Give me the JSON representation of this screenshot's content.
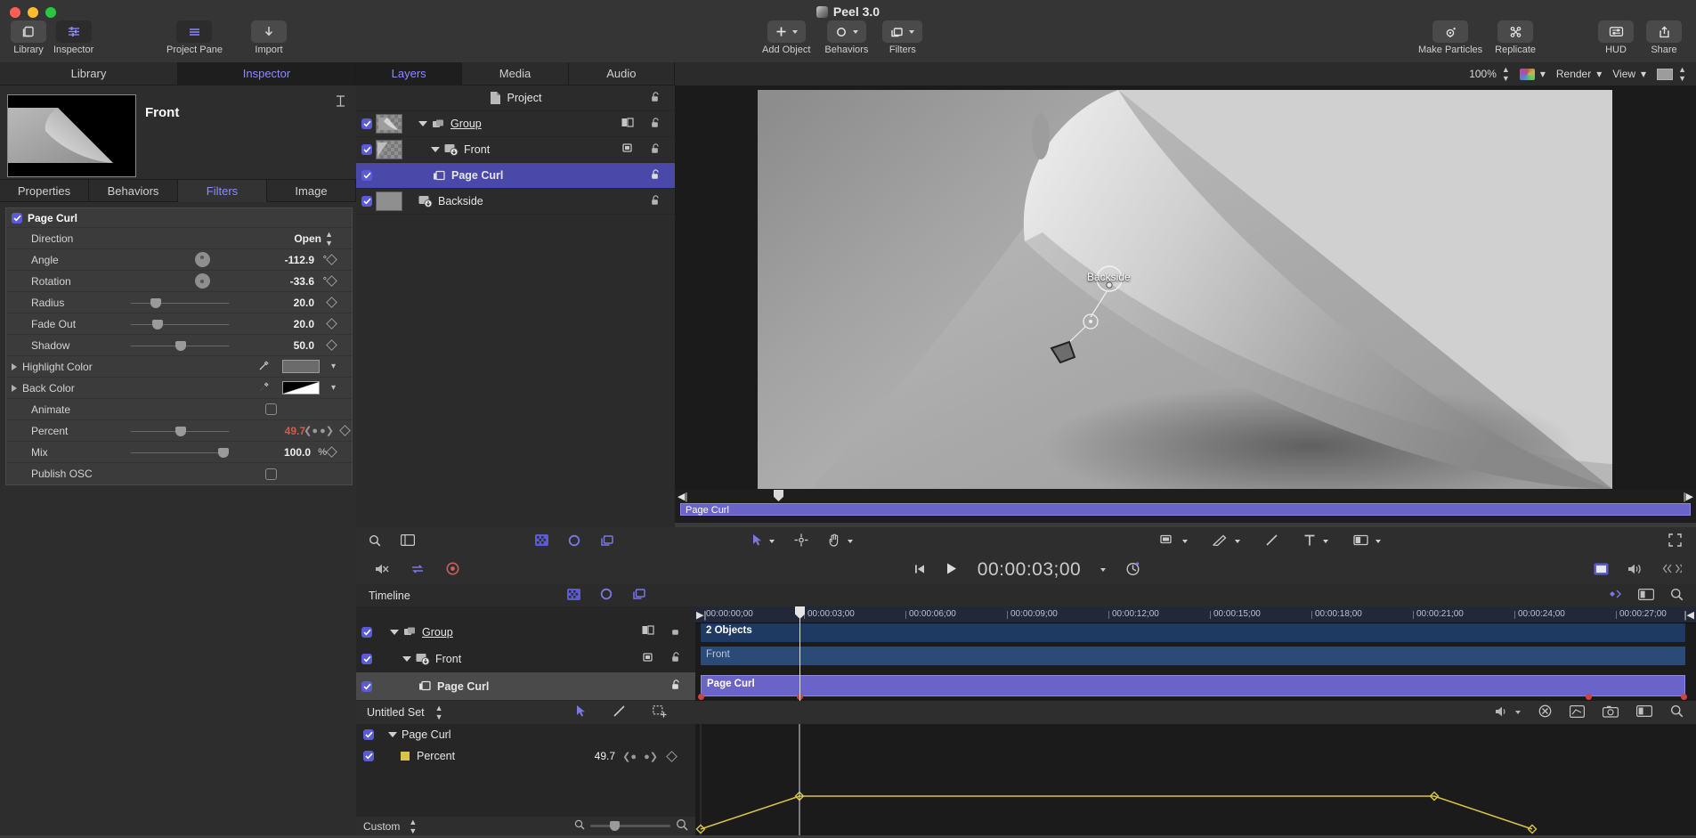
{
  "window": {
    "title": "Peel 3.0",
    "app_icon": "peel-app-icon"
  },
  "toolbar": {
    "left_items": [
      {
        "label": "Library",
        "icon": "library-icon",
        "active": false
      },
      {
        "label": "Inspector",
        "icon": "inspector-sliders-icon",
        "active": true
      }
    ],
    "mid_items": [
      {
        "label": "Project Pane",
        "icon": "project-pane-icon"
      },
      {
        "label": "Import",
        "icon": "import-arrow-down-icon"
      }
    ],
    "center_items": [
      {
        "label": "Add Object",
        "icon": "plus-icon"
      },
      {
        "label": "Behaviors",
        "icon": "gear-icon"
      },
      {
        "label": "Filters",
        "icon": "filters-stack-icon"
      }
    ],
    "right_items": [
      {
        "label": "Make Particles",
        "icon": "particles-icon"
      },
      {
        "label": "Replicate",
        "icon": "replicate-icon"
      },
      {
        "label": "HUD",
        "icon": "hud-icon"
      },
      {
        "label": "Share",
        "icon": "share-icon"
      }
    ]
  },
  "inspector": {
    "tabs": [
      {
        "label": "Library",
        "selected": false
      },
      {
        "label": "Inspector",
        "selected": true
      }
    ],
    "object_title": "Front",
    "pin_icon": "pin-icon",
    "sub_tabs": [
      {
        "label": "Properties",
        "selected": false
      },
      {
        "label": "Behaviors",
        "selected": false
      },
      {
        "label": "Filters",
        "selected": true
      },
      {
        "label": "Image",
        "selected": false
      }
    ],
    "filter": {
      "name": "Page Curl",
      "enabled": true,
      "params": [
        {
          "name": "Direction",
          "type": "popup",
          "value": "Open"
        },
        {
          "name": "Angle",
          "type": "dial",
          "value": "-112.9",
          "unit": "°",
          "keyframe": true
        },
        {
          "name": "Rotation",
          "type": "dial",
          "value": "-33.6",
          "unit": "°",
          "keyframe": true
        },
        {
          "name": "Radius",
          "type": "slider",
          "value": "20.0",
          "unit": "",
          "fill": 0.2,
          "keyframe": true
        },
        {
          "name": "Fade Out",
          "type": "slider",
          "value": "20.0",
          "unit": "",
          "fill": 0.22,
          "keyframe": true
        },
        {
          "name": "Shadow",
          "type": "slider",
          "value": "50.0",
          "unit": "",
          "fill": 0.5,
          "keyframe": true
        },
        {
          "name": "Highlight Color",
          "type": "color",
          "value": "",
          "unit": "",
          "swatch": "#6b6b6b",
          "keyframe": true
        },
        {
          "name": "Back Color",
          "type": "color",
          "value": "",
          "unit": "",
          "swatch": "gradient-black-white",
          "keyframe": true
        },
        {
          "name": "Animate",
          "type": "checkbox",
          "value": "",
          "checked": false
        },
        {
          "name": "Percent",
          "type": "slider",
          "value": "49.7",
          "unit": "",
          "fill": 0.497,
          "animated": true,
          "keyframe": true
        },
        {
          "name": "Mix",
          "type": "slider",
          "value": "100.0",
          "unit": "%",
          "fill": 1.0,
          "keyframe": true
        },
        {
          "name": "Publish OSC",
          "type": "checkbox",
          "value": "",
          "checked": false
        }
      ]
    }
  },
  "layers_panel": {
    "tabs": [
      {
        "label": "Layers",
        "selected": true
      },
      {
        "label": "Media",
        "selected": false
      },
      {
        "label": "Audio",
        "selected": false
      }
    ],
    "rows": [
      {
        "name": "Project",
        "icon": "document-icon",
        "indent": 0,
        "checkbox": null,
        "thumb": false,
        "selected": false,
        "disclosure": null,
        "lock": true
      },
      {
        "name": "Group",
        "icon": "group-icon",
        "indent": 1,
        "checkbox": true,
        "thumb": true,
        "selected": false,
        "disclosure": "open",
        "underline": true,
        "lock": true,
        "extra_icon": "mask-icon"
      },
      {
        "name": "Front",
        "icon": "image-filter-icon",
        "indent": 2,
        "checkbox": true,
        "thumb": true,
        "selected": false,
        "disclosure": "open",
        "lock": true,
        "extra_icon": "filter-badge-icon"
      },
      {
        "name": "Page Curl",
        "icon": "filter-icon",
        "indent": 3,
        "checkbox": true,
        "thumb": false,
        "selected": true,
        "disclosure": null,
        "lock": true
      },
      {
        "name": "Backside",
        "icon": "image-filter-icon",
        "indent": 2,
        "checkbox": true,
        "thumb": true,
        "selected": false,
        "disclosure": null,
        "lock": true
      }
    ]
  },
  "canvas": {
    "zoom": "100%",
    "render_label": "Render",
    "view_label": "View",
    "onscreen_label": "Backside",
    "clip_label": "Page Curl"
  },
  "transport": {
    "timecode": "00:00:03;00",
    "go_to_start_icon": "skip-start-icon",
    "play_icon": "play-icon",
    "loop_icon": "loop-icon"
  },
  "timeline": {
    "title": "Timeline",
    "ruler_ticks": [
      "00:00:00;00",
      "00:00:03;00",
      "00:00:06;00",
      "00:00:09;00",
      "00:00:12;00",
      "00:00:15;00",
      "00:00:18;00",
      "00:00:21;00",
      "00:00:24;00",
      "00:00:27;00"
    ],
    "rows": [
      {
        "name": "Group",
        "indent": 1,
        "checkbox": true,
        "underline": true,
        "track_label": "2 Objects",
        "track_color": "#1e3a63",
        "text_color": "#ffffff"
      },
      {
        "name": "Front",
        "indent": 2,
        "checkbox": true,
        "underline": false,
        "track_label": "Front",
        "track_color": "#2c4a78",
        "text_color": "#b9c7dd"
      },
      {
        "name": "Page Curl",
        "indent": 3,
        "checkbox": true,
        "underline": false,
        "track_label": "Page Curl",
        "track_color": "#6a64c8",
        "text_color": "#ffffff",
        "selected": true
      }
    ],
    "playhead_time": "00:00:03;00"
  },
  "keyframe_editor": {
    "set_name": "Untitled Set",
    "preset_name": "Custom",
    "tool_icons": [
      "arrow-tool-icon",
      "pen-tool-icon",
      "marquee-tool-icon"
    ],
    "rows": [
      {
        "name": "Page Curl",
        "checkbox": true,
        "disclosure": "open",
        "indent": 0,
        "value": "",
        "swatch": null
      },
      {
        "name": "Percent",
        "checkbox": true,
        "disclosure": null,
        "indent": 1,
        "value": "49.7",
        "swatch": "#d8c24a"
      }
    ],
    "curve": {
      "color": "#d8c24a",
      "points": [
        {
          "x": 0.0,
          "y": 0.05
        },
        {
          "x": 0.08,
          "y": 0.52
        },
        {
          "x": 0.73,
          "y": 0.52
        },
        {
          "x": 0.885,
          "y": 0.05
        }
      ]
    }
  },
  "colors": {
    "accent": "#5b5bd6",
    "selection": "#4a48a8",
    "panel_bg": "#2b2b2b",
    "toolbar_bg": "#353535",
    "value_red": "#d9584f",
    "curve_yellow": "#d8c24a"
  }
}
